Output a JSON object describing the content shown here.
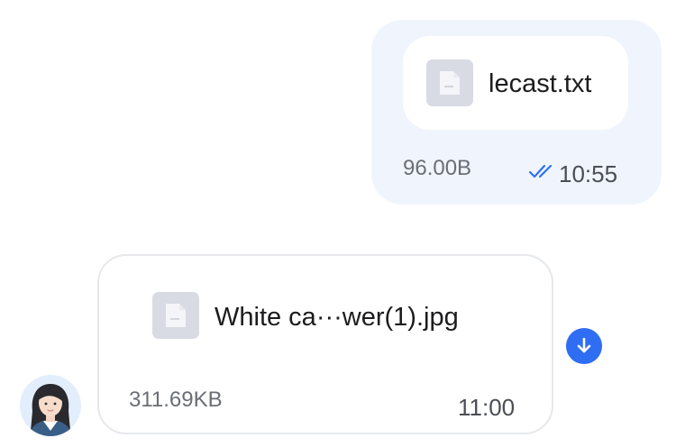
{
  "sent_message": {
    "file_name": "lecast.txt",
    "file_size": "96.00B",
    "time": "10:55",
    "status_icon": "double-check-icon",
    "status_color": "#2f6ef3"
  },
  "received_message": {
    "file_name": "White ca···wer(1).jpg",
    "file_size": "311.69KB",
    "time": "11:00",
    "download_icon": "download-icon",
    "accent_color": "#2f6ef3"
  },
  "avatar": {
    "icon": "user-avatar"
  }
}
